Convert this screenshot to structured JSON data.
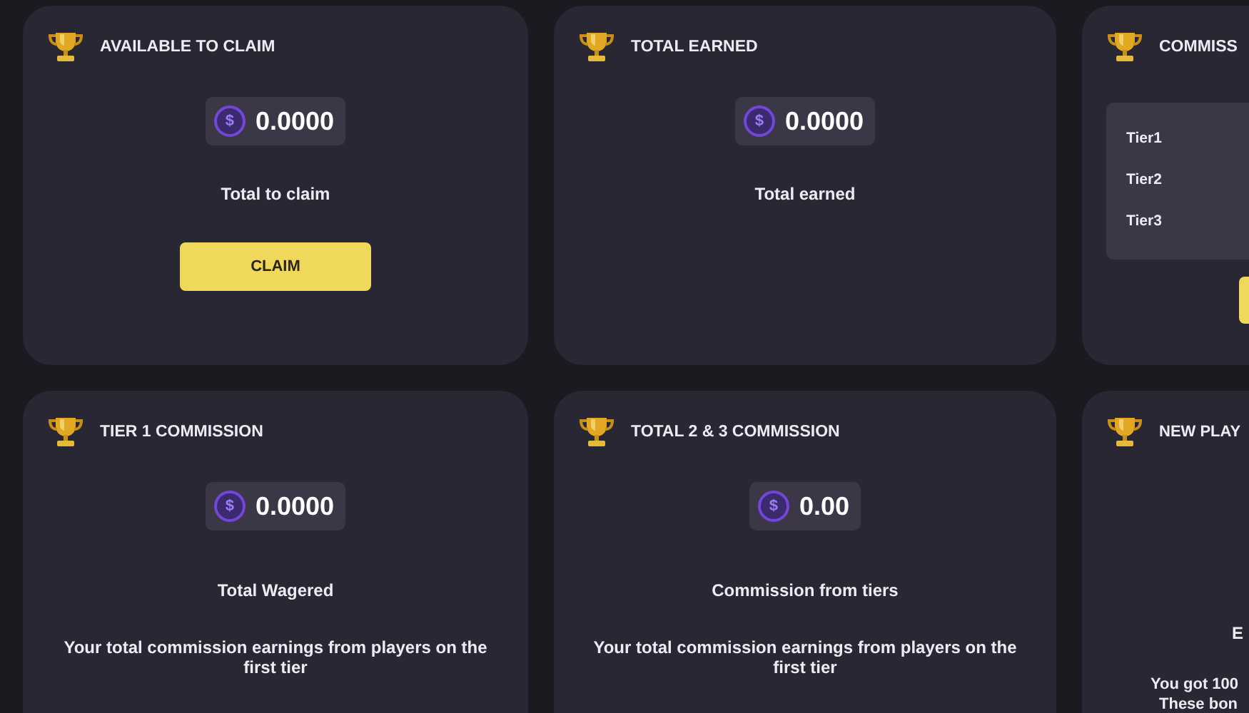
{
  "cards": [
    {
      "kind": "amount",
      "title": "AVAILABLE TO CLAIM",
      "symbol": "$",
      "amount": "0.0000",
      "caption": "Total to claim",
      "button": "CLAIM"
    },
    {
      "kind": "amount",
      "title": "TOTAL EARNED",
      "symbol": "$",
      "amount": "0.0000",
      "caption": "Total earned"
    },
    {
      "kind": "tiers",
      "title": "COMMISS",
      "tiers": [
        "Tier1",
        "Tier2",
        "Tier3"
      ]
    },
    {
      "kind": "amount",
      "title": "TIER 1 COMMISSION",
      "symbol": "$",
      "amount": "0.0000",
      "caption": "Total Wagered",
      "note": "Your total commission earnings from players on the first tier"
    },
    {
      "kind": "amount",
      "title": "TOTAL 2 & 3 COMMISSION",
      "symbol": "$",
      "amount": "0.00",
      "caption": "Commission from tiers",
      "note": "Your total commission earnings from players on the first tier"
    },
    {
      "kind": "partial",
      "title": "NEW PLAY",
      "caption": "E",
      "note_lines": [
        "You got 100",
        "These bon"
      ]
    }
  ]
}
